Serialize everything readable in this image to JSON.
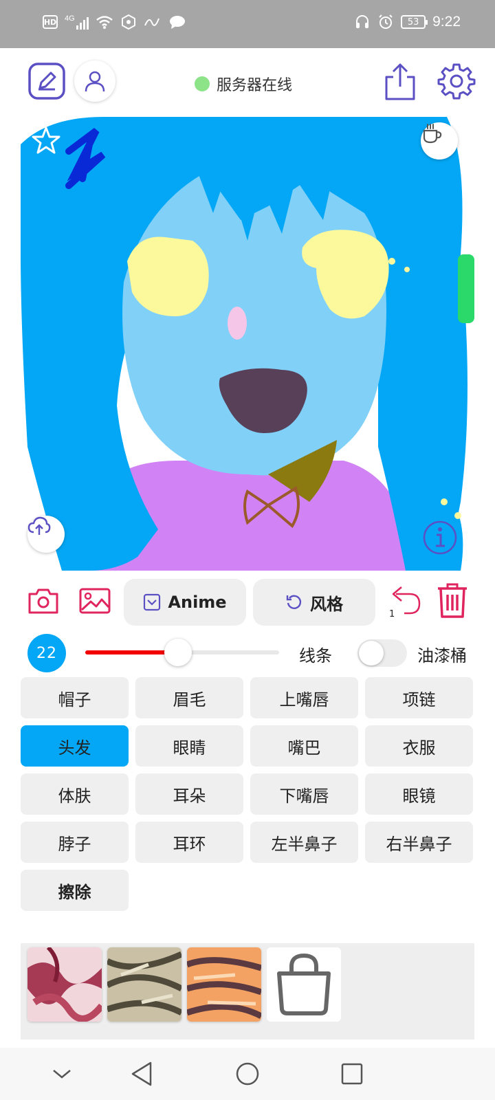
{
  "status_bar": {
    "network_badge": "HD",
    "network_type": "4G",
    "battery": "53",
    "time": "9:22"
  },
  "toolbar": {
    "server_status": "服务器在线",
    "server_status_color": "#8de387"
  },
  "actions": {
    "model_label": "Anime",
    "style_label": "风格",
    "undo_count": "1"
  },
  "brush": {
    "size": "22",
    "slider_level": 0.48,
    "lines_label": "线条",
    "bucket_label": "油漆桶",
    "bucket_enabled": false
  },
  "parts": [
    {
      "label": "帽子"
    },
    {
      "label": "眉毛"
    },
    {
      "label": "上嘴唇"
    },
    {
      "label": "项链"
    },
    {
      "label": "头发",
      "selected": true
    },
    {
      "label": "眼睛"
    },
    {
      "label": "嘴巴"
    },
    {
      "label": "衣服"
    },
    {
      "label": "体肤"
    },
    {
      "label": "耳朵"
    },
    {
      "label": "下嘴唇"
    },
    {
      "label": "眼镜"
    },
    {
      "label": "脖子"
    },
    {
      "label": "耳环"
    },
    {
      "label": "左半鼻子"
    },
    {
      "label": "右半鼻子"
    },
    {
      "label": "擦除",
      "bold": true
    }
  ],
  "colors": {
    "accent_purple": "#5b4fc4",
    "accent_red": "#e0245e",
    "selected_part": "#04a7f5",
    "hair": "#04a7f5",
    "skin": "#80d0f8",
    "eyes": "#fbf99c",
    "mouth": "#584059",
    "clothes": "#d182f5"
  }
}
